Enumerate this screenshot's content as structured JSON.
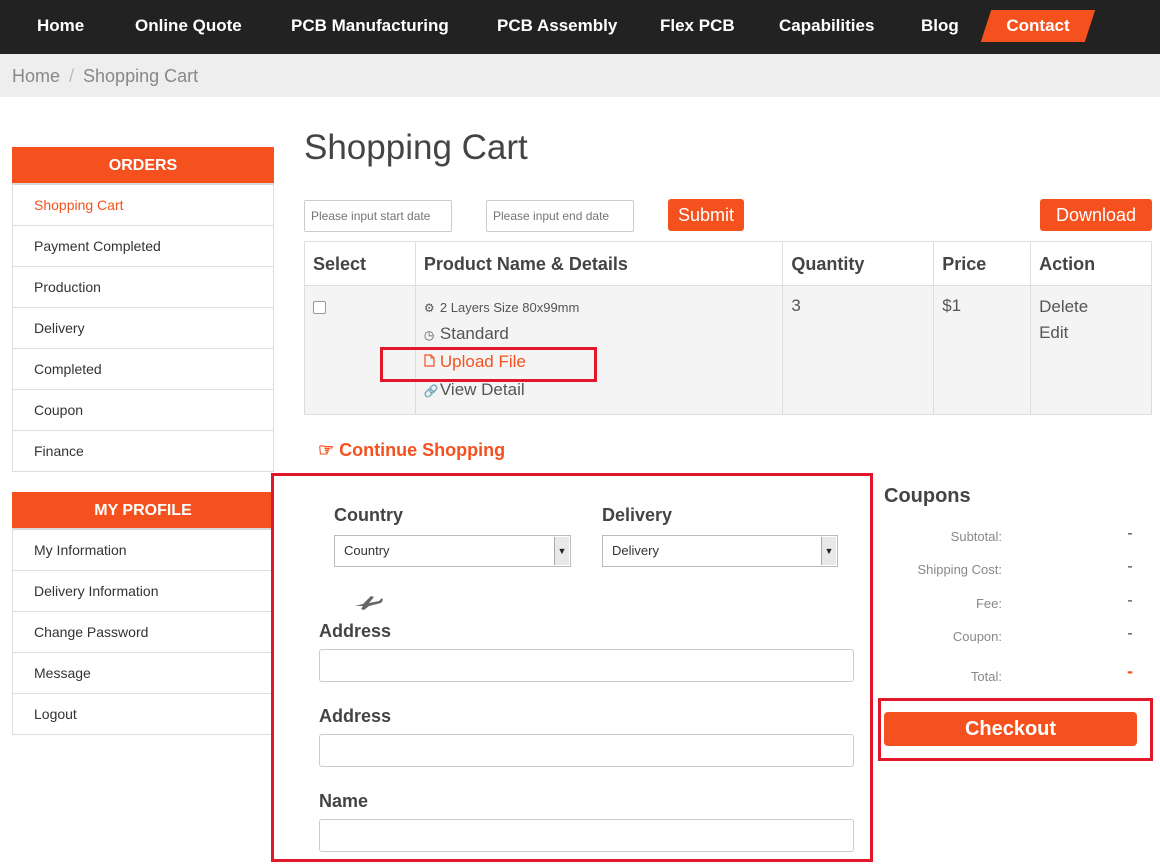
{
  "nav": {
    "items": [
      "Home",
      "Online Quote",
      "PCB Manufacturing",
      "PCB Assembly",
      "Flex PCB",
      "Capabilities",
      "Blog"
    ],
    "contact": "Contact"
  },
  "breadcrumb": {
    "home": "Home",
    "separator": "/",
    "current": "Shopping Cart"
  },
  "sidebar": {
    "orders_title": "ORDERS",
    "orders": [
      "Shopping Cart",
      "Payment Completed",
      "Production",
      "Delivery",
      "Completed",
      "Coupon",
      "Finance"
    ],
    "profile_title": "MY PROFILE",
    "profile": [
      "My Information",
      "Delivery Information",
      "Change Password",
      "Message",
      "Logout"
    ]
  },
  "main": {
    "title": "Shopping Cart",
    "start_date_placeholder": "Please input start date",
    "end_date_placeholder": "Please input end date",
    "submit": "Submit",
    "download": "Download"
  },
  "table": {
    "headers": [
      "Select",
      "Product Name & Details",
      "Quantity",
      "Price",
      "Action"
    ],
    "row": {
      "spec": "2 Layers Size 80x99mm",
      "standard": "Standard",
      "upload": "Upload File",
      "view": "View Detail",
      "quantity": "3",
      "price": "$1",
      "delete": "Delete",
      "edit": "Edit"
    }
  },
  "continue_shopping": "Continue Shopping",
  "form": {
    "country_label": "Country",
    "country_value": "Country",
    "delivery_label": "Delivery",
    "delivery_value": "Delivery",
    "address1_label": "Address",
    "address2_label": "Address",
    "name_label": "Name"
  },
  "summary": {
    "title": "Coupons",
    "rows": [
      {
        "label": "Subtotal:",
        "value": "-"
      },
      {
        "label": "Shipping Cost:",
        "value": "-"
      },
      {
        "label": "Fee:",
        "value": "-"
      },
      {
        "label": "Coupon:",
        "value": "-"
      },
      {
        "label": "Total:",
        "value": "-"
      }
    ],
    "checkout": "Checkout"
  },
  "colors": {
    "accent": "#f4511e",
    "nav_bg": "#222222",
    "highlight": "#e3172a"
  }
}
